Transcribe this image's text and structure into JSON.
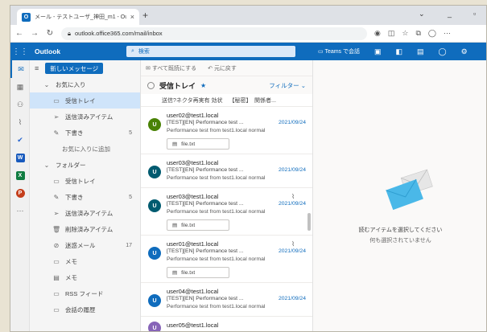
{
  "browser": {
    "tab_title": "メール - テストユーザ_神田_m1 - Outlook",
    "tab_close": "×",
    "new_tab": "+",
    "win_min": "⌄",
    "win_restore": "▫",
    "win_close": "×",
    "url": "outlook.office365.com/mail/inbox"
  },
  "topbar": {
    "app_name": "Outlook",
    "search_placeholder": "検索",
    "teams_label": "Teams で会話"
  },
  "folders": {
    "new_mail": "新しいメッセージ",
    "favorites": "お気に入り",
    "items": [
      {
        "label": "受信トレイ",
        "count": ""
      },
      {
        "label": "送信済みアイテム",
        "count": ""
      },
      {
        "label": "下書き",
        "count": "5"
      },
      {
        "label": "お気に入りに追加",
        "count": ""
      }
    ],
    "folders_header": "フォルダー",
    "folder_items": [
      {
        "label": "受信トレイ",
        "count": ""
      },
      {
        "label": "下書き",
        "count": "5"
      },
      {
        "label": "送信済みアイテム",
        "count": ""
      },
      {
        "label": "削除済みアイテム",
        "count": ""
      },
      {
        "label": "迷惑メール",
        "count": "17"
      },
      {
        "label": "メモ",
        "count": ""
      },
      {
        "label": "メモ",
        "count": ""
      },
      {
        "label": "RSS フィード",
        "count": ""
      },
      {
        "label": "会話の履歴",
        "count": ""
      }
    ]
  },
  "list": {
    "mark_all_read": "すべて既読にする",
    "undo": "元に戻す",
    "title": "受信トレイ",
    "filter": "フィルター",
    "pinned_text": "送信?ネクタ再実有 効状",
    "pinned_text2": "【秘密】　関係者...",
    "messages": [
      {
        "sender": "user02@test1.local",
        "subject": "[TEST][EN] Performance test ...",
        "date": "2021/09/24",
        "preview": "Performance test from test1.local normal",
        "attachment": "file.txt",
        "avatar": "U",
        "avatar_color": "#498205"
      },
      {
        "sender": "user03@test1.local",
        "subject": "[TEST][EN] Performance test ...",
        "date": "2021/09/24",
        "preview": "Performance test from test1.local normal",
        "attachment": "",
        "avatar": "U",
        "avatar_color": "#005b70"
      },
      {
        "sender": "user03@test1.local",
        "subject": "[TEST][EN] Performance test ...",
        "date": "2021/09/24",
        "preview": "Performance test from test1.local normal",
        "attachment": "file.txt",
        "avatar": "U",
        "avatar_color": "#005b70"
      },
      {
        "sender": "user01@test1.local",
        "subject": "[TEST][EN] Performance test ...",
        "date": "2021/09/24",
        "preview": "Performance test from test1.local normal",
        "attachment": "file.txt",
        "avatar": "U",
        "avatar_color": "#0f6cbd"
      },
      {
        "sender": "user04@test1.local",
        "subject": "[TEST][EN] Performance test ...",
        "date": "2021/09/24",
        "preview": "Performance test from test1.local normal",
        "attachment": "",
        "avatar": "U",
        "avatar_color": "#0f6cbd"
      },
      {
        "sender": "user05@test1.local",
        "subject": "",
        "date": "",
        "preview": "",
        "attachment": "",
        "avatar": "U",
        "avatar_color": "#8764b8"
      }
    ]
  },
  "reading": {
    "empty_title": "読むアイテムを選択してください",
    "empty_sub": "何も選択されていません"
  },
  "colors": {
    "brand": "#0f6cbd",
    "selected": "#cfe4fa"
  }
}
